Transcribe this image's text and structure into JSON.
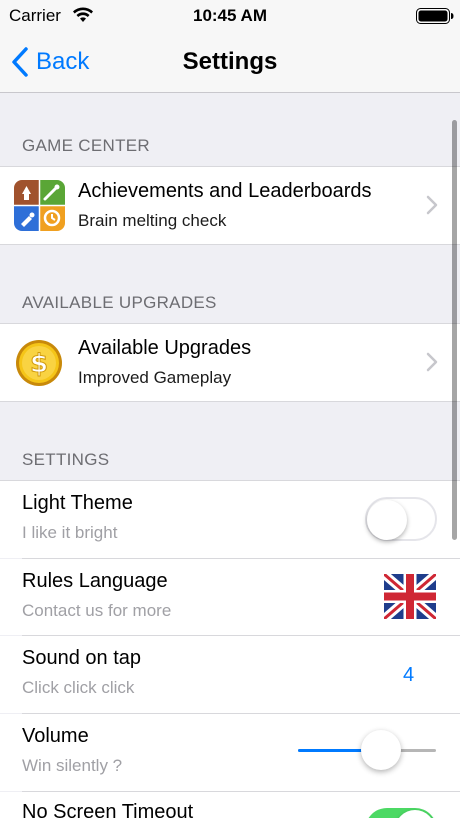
{
  "status_bar": {
    "carrier": "Carrier",
    "time": "10:45 AM"
  },
  "nav": {
    "back_label": "Back",
    "title": "Settings"
  },
  "sections": {
    "game_center": "GAME CENTER",
    "upgrades": "AVAILABLE UPGRADES",
    "settings": "SETTINGS"
  },
  "game_center_cell": {
    "title": "Achievements and Leaderboards",
    "subtitle": "Brain melting check",
    "icon": "game-center-icon"
  },
  "upgrades_cell": {
    "title": "Available Upgrades",
    "subtitle": "Improved Gameplay",
    "icon": "dollar-coin-icon"
  },
  "settings_rows": {
    "light_theme": {
      "title": "Light Theme",
      "subtitle": "I like it bright",
      "enabled": false
    },
    "rules_language": {
      "title": "Rules Language",
      "subtitle": "Contact us for more",
      "flag": "uk-flag-icon"
    },
    "sound_on_tap": {
      "title": "Sound on tap",
      "subtitle": "Click click click",
      "value": "4"
    },
    "volume": {
      "title": "Volume",
      "subtitle": "Win silently ?",
      "level": 0.6
    },
    "no_screen_timeout": {
      "title": "No Screen Timeout",
      "enabled": true
    }
  },
  "colors": {
    "accent": "#007aff",
    "toggle_on": "#4cd964",
    "background": "#efeff4"
  }
}
